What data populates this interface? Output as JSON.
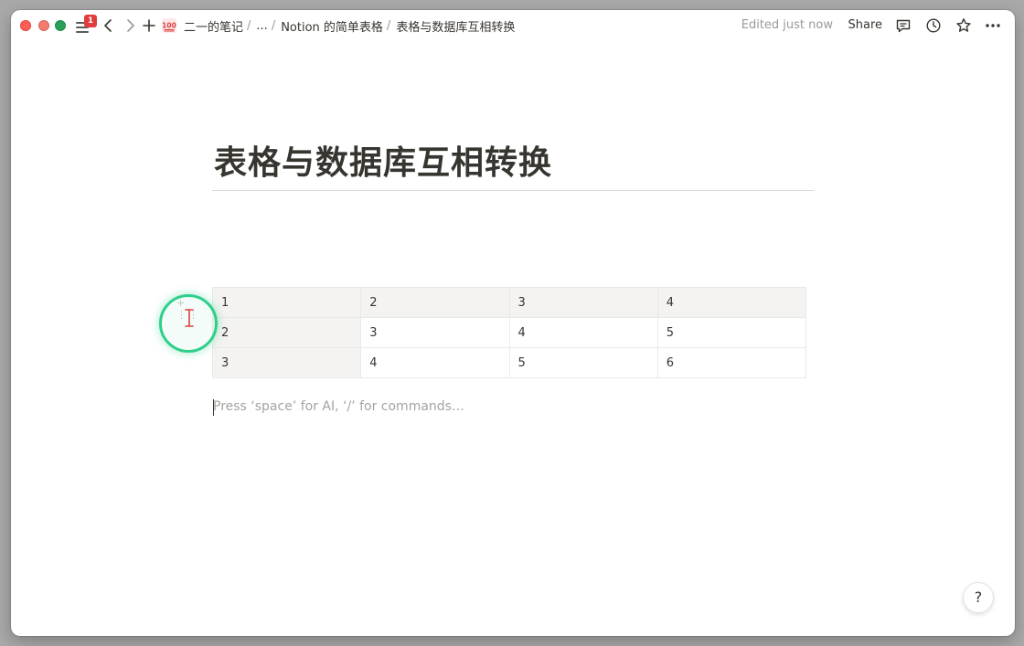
{
  "titlebar": {
    "notification_count": "1",
    "breadcrumbs": [
      {
        "label": "二一的笔记"
      },
      {
        "label": "..."
      },
      {
        "label": "Notion 的简单表格"
      },
      {
        "label": "表格与数据库互相转换"
      }
    ],
    "edited_status": "Edited just now",
    "share_label": "Share",
    "icons": [
      "sidebar-menu-icon",
      "back-icon",
      "forward-icon",
      "new-page-icon",
      "hundred-points-icon",
      "comment-icon",
      "clock-icon",
      "star-icon",
      "more-icon"
    ]
  },
  "page": {
    "title": "表格与数据库互相转换",
    "table": {
      "rows": [
        [
          "1",
          "2",
          "3",
          "4"
        ],
        [
          "2",
          "3",
          "4",
          "5"
        ],
        [
          "3",
          "4",
          "5",
          "6"
        ]
      ]
    },
    "placeholder": "Press ‘space’ for AI, ‘/’ for commands…"
  },
  "help_label": "?",
  "colors": {
    "cursor_ring": "#2ecf8b",
    "badge": "#e03e3e",
    "header_bg": "#f4f3f1"
  }
}
